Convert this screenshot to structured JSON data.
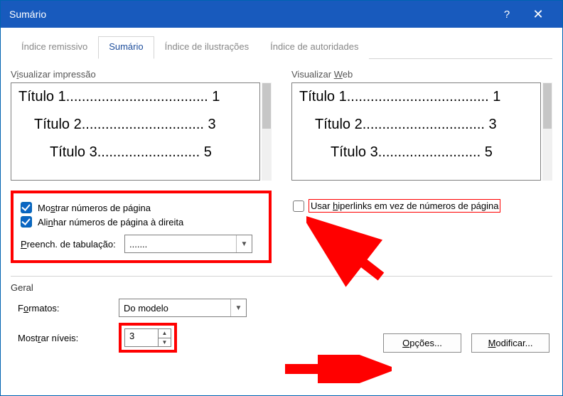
{
  "title": "Sumário",
  "titlebar": {
    "help": "?",
    "close": "✕"
  },
  "tabs": {
    "t0": "Índice remissivo",
    "t1": "Sumário",
    "t2": "Índice de ilustrações",
    "t3": "Índice de autoridades"
  },
  "left": {
    "label_html": "V<span class='ul'>i</span>sualizar impressão",
    "preview": {
      "r1": "Título 1.................................... 1",
      "r2": "Título 2............................... 3",
      "r3": "Título 3.......................... 5"
    },
    "cb1_html": "Mo<span class='ul'>s</span>trar números de página",
    "cb2_html": "Ali<span class='ul'>n</span>har números de página à direita",
    "leader_label_html": "<span class='ul'>P</span>reench. de tabulação:",
    "leader_value": "......."
  },
  "right": {
    "label_html": "Visualizar <span class='ul'>W</span>eb",
    "preview": {
      "r1": "Título 1.................................... 1",
      "r2": "Título 2............................... 3",
      "r3": "Título 3.......................... 5"
    },
    "cb_html": "Usar <span class='ul'>h</span>iperlinks em vez de números de página"
  },
  "general": {
    "label": "Geral",
    "formats_label_html": "F<span class='ul'>o</span>rmatos:",
    "formats_value": "Do modelo",
    "levels_label_html": "Most<span class='ul'>r</span>ar níveis:",
    "levels_value": "3"
  },
  "buttons": {
    "options_html": "<span class='ul'>O</span>pções...",
    "modify_html": "<span class='ul'>M</span>odificar..."
  }
}
